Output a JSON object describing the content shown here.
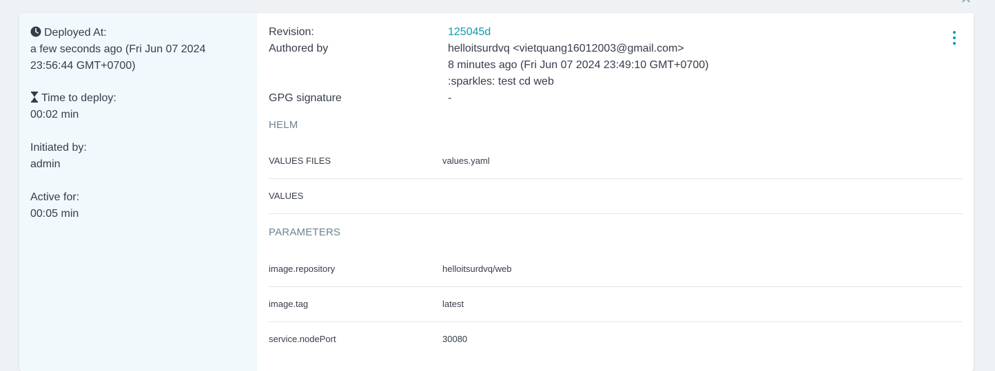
{
  "left": {
    "deployed_at_label": "Deployed At:",
    "deployed_at_line1": "a few seconds ago (Fri Jun 07 2024",
    "deployed_at_line2": "23:56:44 GMT+0700)",
    "time_to_deploy_label": "Time to deploy:",
    "time_to_deploy_value": "00:02 min",
    "initiated_by_label": "Initiated by:",
    "initiated_by_value": "admin",
    "active_for_label": "Active for:",
    "active_for_value": "00:05 min"
  },
  "revision": {
    "revision_label": "Revision:",
    "revision_value": "125045d",
    "authored_by_label": "Authored by",
    "author": "helloitsurdvq <vietquang16012003@gmail.com>",
    "authored_time": "8 minutes ago (Fri Jun 07 2024 23:49:10 GMT+0700)",
    "message": ":sparkles: test cd web",
    "gpg_label": "GPG signature",
    "gpg_value": "-"
  },
  "helm": {
    "title": "HELM",
    "values_files_label": "VALUES FILES",
    "values_files_value": "values.yaml",
    "values_label": "VALUES"
  },
  "parameters": {
    "title": "PARAMETERS",
    "rows": [
      {
        "key": "image.repository",
        "value": "helloitsurdvq/web"
      },
      {
        "key": "image.tag",
        "value": "latest"
      },
      {
        "key": "service.nodePort",
        "value": "30080"
      }
    ]
  },
  "icons": {
    "clock": "clock-icon",
    "hourglass": "hourglass-icon",
    "kebab": "more-vertical-icon",
    "close": "close-icon"
  },
  "colors": {
    "accent": "#139aa8",
    "left_panel_bg": "#f2f9fc",
    "section_title": "#6b8492"
  }
}
